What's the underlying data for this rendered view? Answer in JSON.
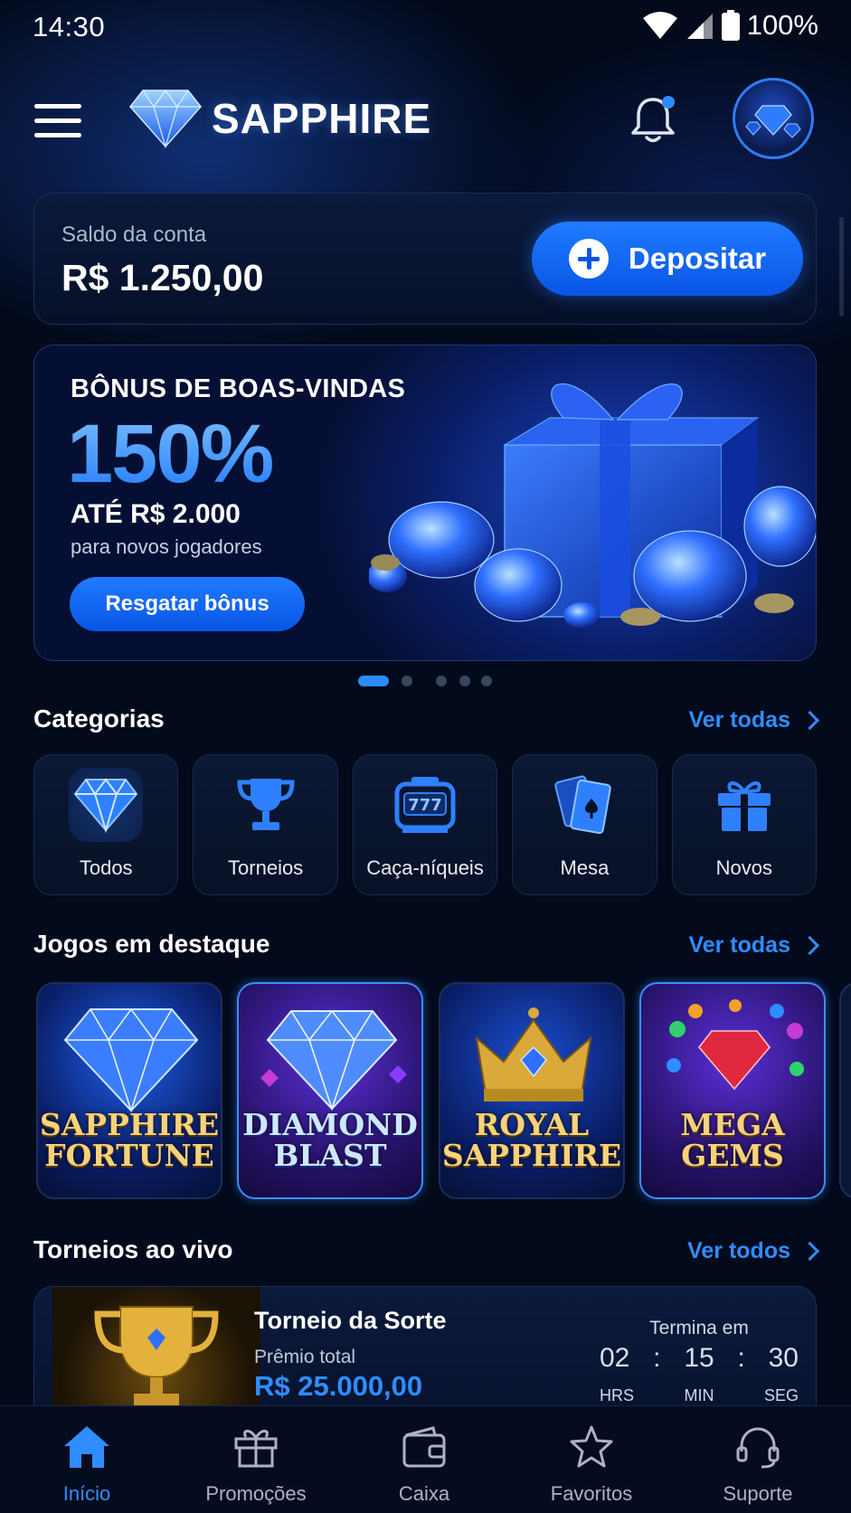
{
  "status_bar": {
    "time": "14:30",
    "battery": "100%"
  },
  "header": {
    "brand": "SAPPHIRE"
  },
  "balance": {
    "label": "Saldo da conta",
    "value": "R$ 1.250,00",
    "deposit_label": "Depositar"
  },
  "banner": {
    "title": "BÔNUS DE BOAS-VINDAS",
    "percent": "150%",
    "subtitle": "ATÉ R$ 2.000",
    "note": "para novos jogadores",
    "button": "Resgatar bônus",
    "slides_total": 5,
    "active_slide": 1
  },
  "categories": {
    "title": "Categorias",
    "link": "Ver todas",
    "items": [
      {
        "label": "Todos",
        "icon": "diamond-icon"
      },
      {
        "label": "Torneios",
        "icon": "trophy-icon"
      },
      {
        "label": "Caça-níqueis",
        "icon": "slot-machine-icon"
      },
      {
        "label": "Mesa",
        "icon": "playing-cards-icon"
      },
      {
        "label": "Novos",
        "icon": "gift-icon"
      }
    ]
  },
  "featured": {
    "title": "Jogos em destaque",
    "link": "Ver todas",
    "games": [
      {
        "line1": "SAPPHIRE",
        "line2": "FORTUNE"
      },
      {
        "line1": "DIAMOND",
        "line2": "BLAST"
      },
      {
        "line1": "ROYAL",
        "line2": "SAPPHIRE"
      },
      {
        "line1": "MEGA",
        "line2": "GEMS"
      }
    ]
  },
  "tournaments": {
    "title": "Torneios ao vivo",
    "link": "Ver todos",
    "item": {
      "name": "Torneio da Sorte",
      "prize_label": "Prêmio total",
      "prize": "R$ 25.000,00",
      "ends_label": "Termina em",
      "hours": "02",
      "minutes": "15",
      "seconds": "30",
      "sep": ":",
      "units": [
        "HRS",
        "MIN",
        "SEG"
      ]
    }
  },
  "bottom_nav": {
    "items": [
      {
        "label": "Início",
        "icon": "home-icon"
      },
      {
        "label": "Promoções",
        "icon": "gift-icon"
      },
      {
        "label": "Caixa",
        "icon": "wallet-icon"
      },
      {
        "label": "Favoritos",
        "icon": "star-icon"
      },
      {
        "label": "Suporte",
        "icon": "headset-icon"
      }
    ]
  },
  "colors": {
    "accent": "#2f8dff",
    "background": "#030a1c",
    "gold": "#f6d27a"
  }
}
